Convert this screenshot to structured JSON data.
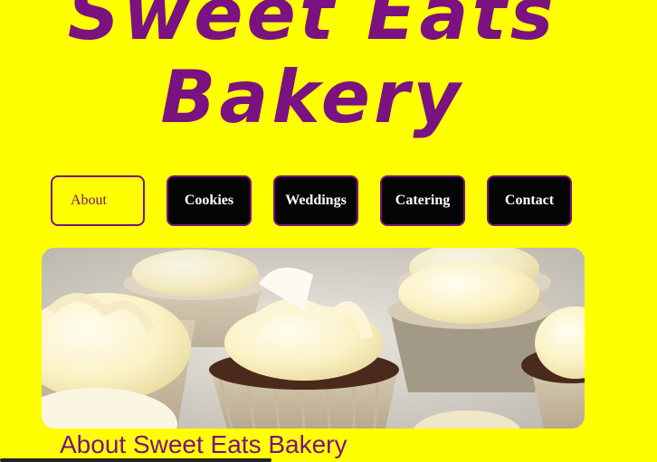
{
  "header": {
    "title_line1": "Sweet Eats",
    "title_line2": "Bakery"
  },
  "nav": {
    "items": [
      {
        "label": "About",
        "active": true
      },
      {
        "label": "Cookies",
        "active": false
      },
      {
        "label": "Weddings",
        "active": false
      },
      {
        "label": "Catering",
        "active": false
      },
      {
        "label": "Contact",
        "active": false
      }
    ]
  },
  "hero": {
    "image_subject": "cupcakes with cream frosting"
  },
  "main": {
    "heading": "About Sweet Eats Bakery"
  },
  "colors": {
    "background": "#ffff00",
    "accent": "#7a1282",
    "button_dark": "#050505",
    "button_text": "#ffffff"
  }
}
